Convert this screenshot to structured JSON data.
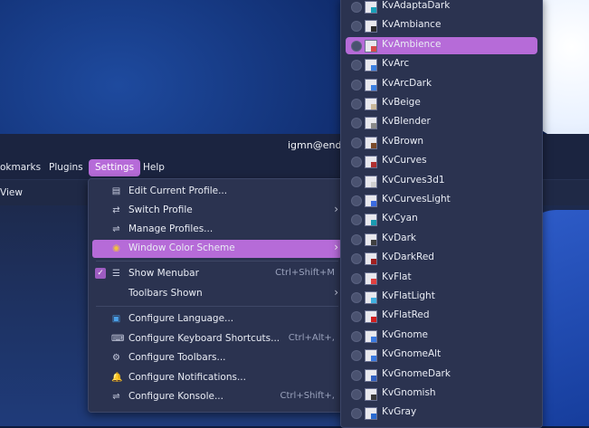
{
  "window": {
    "title": "igmn@endea"
  },
  "menubar": {
    "items": [
      "okmarks",
      "Plugins",
      "Settings",
      "Help"
    ],
    "active": "Settings"
  },
  "toolbar": {
    "view_label": "View"
  },
  "settings_menu": {
    "items": [
      {
        "icon": "profile-edit-icon",
        "label": "Edit Current Profile...",
        "shortcut": "",
        "submenu": false
      },
      {
        "icon": "switch-profile-icon",
        "label": "Switch Profile",
        "shortcut": "",
        "submenu": true
      },
      {
        "icon": "manage-profiles-icon",
        "label": "Manage Profiles...",
        "shortcut": "",
        "submenu": false
      },
      {
        "icon": "color-scheme-icon",
        "label": "Window Color Scheme",
        "shortcut": "",
        "submenu": true
      },
      {
        "icon": "checkbox-icon",
        "label": "Show Menubar",
        "shortcut": "Ctrl+Shift+M",
        "submenu": false
      },
      {
        "icon": "",
        "label": "Toolbars Shown",
        "shortcut": "",
        "submenu": true
      },
      {
        "icon": "language-icon",
        "label": "Configure Language...",
        "shortcut": "",
        "submenu": false
      },
      {
        "icon": "keyboard-icon",
        "label": "Configure Keyboard Shortcuts...",
        "shortcut": "Ctrl+Alt+,",
        "submenu": false
      },
      {
        "icon": "toolbar-icon",
        "label": "Configure Toolbars...",
        "shortcut": "",
        "submenu": false
      },
      {
        "icon": "bell-icon",
        "label": "Configure Notifications...",
        "shortcut": "",
        "submenu": false
      },
      {
        "icon": "settings-icon",
        "label": "Configure Konsole...",
        "shortcut": "Ctrl+Shift+,",
        "submenu": false
      }
    ],
    "active_index": 3,
    "show_menubar_checked": true
  },
  "color_schemes": {
    "items": [
      {
        "label": "KvAdaptaDark",
        "color": "#1aa0b8"
      },
      {
        "label": "KvAmbiance",
        "color": "#2b2b2b"
      },
      {
        "label": "KvAmbience",
        "color": "#d84a4a"
      },
      {
        "label": "KvArc",
        "color": "#3d80e0"
      },
      {
        "label": "KvArcDark",
        "color": "#3d80e0"
      },
      {
        "label": "KvBeige",
        "color": "#c9b89a"
      },
      {
        "label": "KvBlender",
        "color": "#8a8a8a"
      },
      {
        "label": "KvBrown",
        "color": "#7a4a2a"
      },
      {
        "label": "KvCurves",
        "color": "#b03030"
      },
      {
        "label": "KvCurves3d1",
        "color": "#d0d0d0"
      },
      {
        "label": "KvCurvesLight",
        "color": "#3a6ae0"
      },
      {
        "label": "KvCyan",
        "color": "#1a9ab0"
      },
      {
        "label": "KvDark",
        "color": "#404040"
      },
      {
        "label": "KvDarkRed",
        "color": "#a02020"
      },
      {
        "label": "KvFlat",
        "color": "#e04040"
      },
      {
        "label": "KvFlatLight",
        "color": "#40b0e0"
      },
      {
        "label": "KvFlatRed",
        "color": "#d02020"
      },
      {
        "label": "KvGnome",
        "color": "#3a7ae0"
      },
      {
        "label": "KvGnomeAlt",
        "color": "#3a7ae0"
      },
      {
        "label": "KvGnomeDark",
        "color": "#3060c0"
      },
      {
        "label": "KvGnomish",
        "color": "#3a3a3a"
      },
      {
        "label": "KvGray",
        "color": "#2a6ad0"
      }
    ],
    "active_index": 2
  }
}
